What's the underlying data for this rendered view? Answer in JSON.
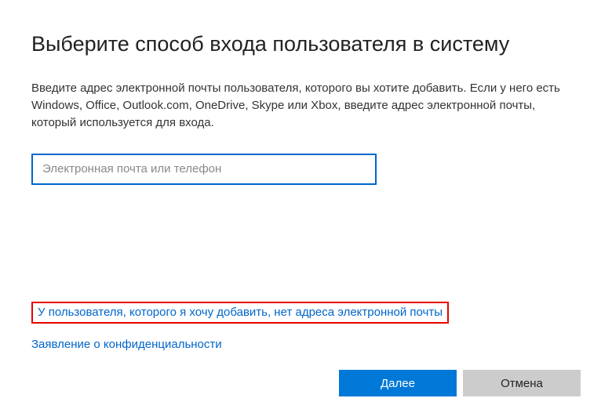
{
  "dialog": {
    "title": "Выберите способ входа пользователя в систему",
    "description": "Введите адрес электронной почты пользователя, которого вы хотите добавить. Если у него есть Windows, Office, Outlook.com, OneDrive, Skype или Xbox, введите адрес электронной почты, который используется для входа.",
    "input": {
      "value": "",
      "placeholder": "Электронная почта или телефон"
    },
    "links": {
      "no_email": "У пользователя, которого я хочу добавить, нет адреса электронной почты",
      "privacy": "Заявление о конфиденциальности"
    },
    "buttons": {
      "next": "Далее",
      "cancel": "Отмена"
    }
  },
  "colors": {
    "accent": "#0078d7",
    "link": "#0066cc",
    "highlight_border": "#e60000"
  }
}
